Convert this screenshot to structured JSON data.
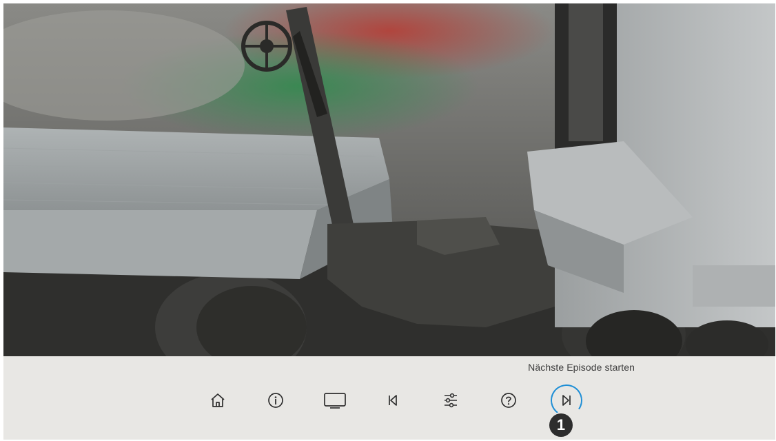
{
  "player": {
    "hint_text": "Nächste Episode starten",
    "callout_number": "1",
    "accent_color": "#1f8fd6",
    "focused_button": "next-episode"
  },
  "toolbar": {
    "buttons": [
      {
        "name": "home-button",
        "icon": "home-icon"
      },
      {
        "name": "info-button",
        "icon": "info-icon"
      },
      {
        "name": "tv-button",
        "icon": "tv-icon"
      },
      {
        "name": "previous-button",
        "icon": "skip-previous-icon"
      },
      {
        "name": "settings-button",
        "icon": "sliders-icon"
      },
      {
        "name": "help-button",
        "icon": "help-icon"
      },
      {
        "name": "next-episode-button",
        "icon": "skip-next-icon"
      }
    ]
  }
}
